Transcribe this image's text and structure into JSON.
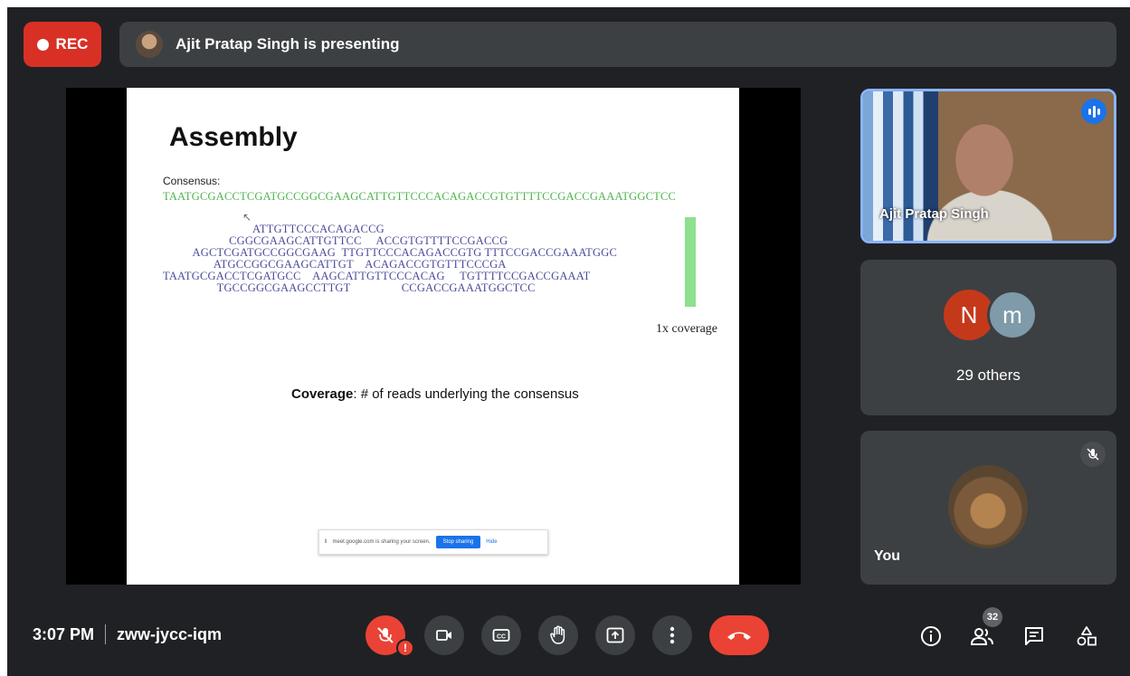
{
  "recording": {
    "label": "REC"
  },
  "presenter_bar": {
    "text": "Ajit Pratap Singh is presenting"
  },
  "slide": {
    "title": "Assembly",
    "consensus_label": "Consensus:",
    "consensus_seq": "TAATGCGACCTCGATGCCGGCGAAGCATTGTTCCCACAGACCGTGTTTTCCGACCGAAATGGCTCC",
    "reads": [
      "                              ATTGTTCCCACAGACCG",
      "                      CGGCGAAGCATTGTTCC     ACCGTGTTTTCCGACCG",
      "          AGCTCGATGCCGGCGAAG  TTGTTCCCACAGACCGTG TTTCCGACCGAAATGGC",
      "                 ATGCCGGCGAAGCATTGT    ACAGACCGTGTTTCCCGA",
      "TAATGCGACCTCGATGCC    AAGCATTGTTCCCACAG     TGTTTTCCGACCGAAAT",
      "                  TGCCGGCGAAGCCTTGT                 CCGACCGAAATGGCTCC"
    ],
    "coverage_callout": "1x coverage",
    "coverage_term": "Coverage",
    "coverage_definition": ": # of reads underlying the consensus",
    "share_notice": {
      "text": "meet.google.com is sharing your screen.",
      "stop_label": "Stop sharing",
      "hide_label": "Hide"
    }
  },
  "tiles": {
    "presenter_name": "Ajit Pratap Singh",
    "others": {
      "initials": [
        "N",
        "m"
      ],
      "label": "29 others"
    },
    "self": {
      "label": "You"
    }
  },
  "bottom": {
    "time": "3:07 PM",
    "meeting_code": "zww-jycc-iqm",
    "warning_mark": "!",
    "participants_count": "32"
  },
  "colors": {
    "accent": "#1a73e8",
    "danger": "#ea4335",
    "surface": "#3c4043",
    "background": "#202124"
  },
  "icons": [
    "mic-off-icon",
    "camera-icon",
    "captions-icon",
    "raise-hand-icon",
    "present-icon",
    "more-icon",
    "end-call-icon",
    "info-icon",
    "people-icon",
    "chat-icon",
    "activities-icon"
  ]
}
